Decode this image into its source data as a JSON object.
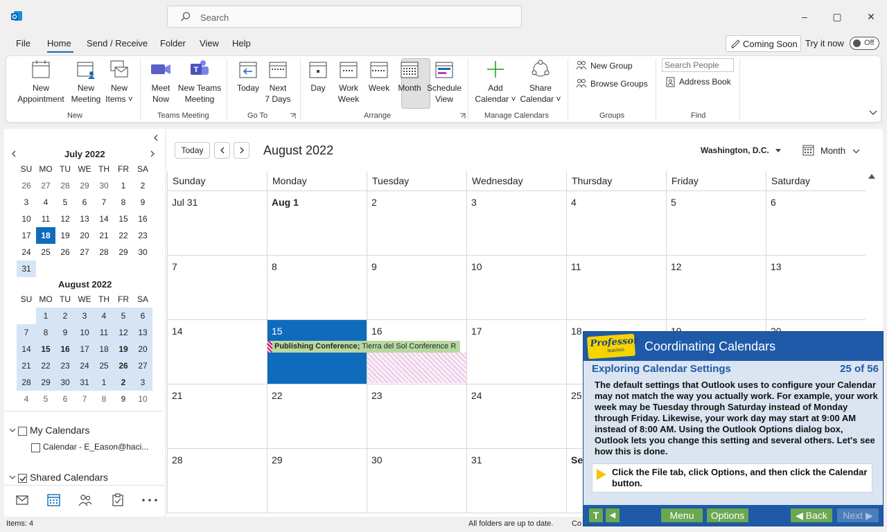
{
  "window": {
    "search_placeholder": "Search",
    "minimize": "–",
    "maximize": "▢",
    "close": "✕"
  },
  "menu": {
    "items": [
      "File",
      "Home",
      "Send / Receive",
      "Folder",
      "View",
      "Help"
    ],
    "coming_soon": "Coming Soon",
    "try_it_now": "Try it now",
    "toggle_state": "Off"
  },
  "ribbon": {
    "new_appointment": [
      "New",
      "Appointment"
    ],
    "new_meeting": [
      "New",
      "Meeting"
    ],
    "new_items": [
      "New",
      "Items ˅"
    ],
    "group_new": "New",
    "meet_now": [
      "Meet",
      "Now"
    ],
    "new_teams_meeting": [
      "New Teams",
      "Meeting"
    ],
    "group_teams": "Teams Meeting",
    "today": "Today",
    "next_7_days": [
      "Next",
      "7 Days"
    ],
    "group_goto": "Go To",
    "day": "Day",
    "work_week": [
      "Work",
      "Week"
    ],
    "week": "Week",
    "month": "Month",
    "schedule_view": [
      "Schedule",
      "View"
    ],
    "group_arrange": "Arrange",
    "add_calendar": [
      "Add",
      "Calendar ˅"
    ],
    "share_calendar": [
      "Share",
      "Calendar ˅"
    ],
    "group_manage": "Manage Calendars",
    "new_group": "New Group",
    "browse_groups": "Browse Groups",
    "group_groups": "Groups",
    "search_people_placeholder": "Search People",
    "address_book": "Address Book",
    "group_find": "Find"
  },
  "mini_calendar": {
    "july_title": "July 2022",
    "august_title": "August 2022",
    "weekdays": [
      "SU",
      "MO",
      "TU",
      "WE",
      "TH",
      "FR",
      "SA"
    ],
    "july_rows": [
      [
        "26",
        "27",
        "28",
        "29",
        "30",
        "1",
        "2"
      ],
      [
        "3",
        "4",
        "5",
        "6",
        "7",
        "8",
        "9"
      ],
      [
        "10",
        "11",
        "12",
        "13",
        "14",
        "15",
        "16"
      ],
      [
        "17",
        "18",
        "19",
        "20",
        "21",
        "22",
        "23"
      ],
      [
        "24",
        "25",
        "26",
        "27",
        "28",
        "29",
        "30"
      ],
      [
        "31",
        "",
        "",
        "",
        "",
        "",
        ""
      ]
    ],
    "august_rows": [
      [
        "",
        "1",
        "2",
        "3",
        "4",
        "5",
        "6"
      ],
      [
        "7",
        "8",
        "9",
        "10",
        "11",
        "12",
        "13"
      ],
      [
        "14",
        "15",
        "16",
        "17",
        "18",
        "19",
        "20"
      ],
      [
        "21",
        "22",
        "23",
        "24",
        "25",
        "26",
        "27"
      ],
      [
        "28",
        "29",
        "30",
        "31",
        "1",
        "2",
        "3"
      ],
      [
        "4",
        "5",
        "6",
        "7",
        "8",
        "9",
        "10"
      ]
    ]
  },
  "folders": {
    "my_calendars": "My Calendars",
    "calendar_item": "Calendar - E_Eason@haci...",
    "shared_calendars": "Shared Calendars"
  },
  "calendar": {
    "today_button": "Today",
    "title": "August 2022",
    "location": "Washington, D.C.",
    "view": "Month",
    "weekdays": [
      "Sunday",
      "Monday",
      "Tuesday",
      "Wednesday",
      "Thursday",
      "Friday",
      "Saturday"
    ],
    "weeks": [
      [
        "Jul 31",
        "Aug 1",
        "2",
        "3",
        "4",
        "5",
        "6"
      ],
      [
        "7",
        "8",
        "9",
        "10",
        "11",
        "12",
        "13"
      ],
      [
        "14",
        "15",
        "16",
        "17",
        "18",
        "19",
        "20"
      ],
      [
        "21",
        "22",
        "23",
        "24",
        "25",
        "",
        ""
      ],
      [
        "28",
        "29",
        "30",
        "31",
        "Se",
        "",
        ""
      ]
    ],
    "event_bold": "Publishing Conference;",
    "event_rest": " Tierra del Sol Conference R"
  },
  "status": {
    "items": "Items: 4",
    "sync": "All folders are up to date.",
    "connected": "Co"
  },
  "tutorial": {
    "logo": "Professor",
    "logo_small": "teaches",
    "title": "Coordinating Calendars",
    "subtitle": "Exploring Calendar Settings",
    "counter": "25 of 56",
    "body": "The default settings that Outlook uses to configure your Calendar may not match the way you actually work. For example, your work week may be Tuesday through Saturday instead of Monday through Friday. Likewise, your work day may start at 9:00 AM instead of 8:00 AM. Using the Outlook Options dialog box, Outlook lets you change this setting and several others. Let's see how this is done.",
    "instruction": "Click the File tab, click Options, and then click the Calendar button.",
    "btn_t": "T",
    "btn_audio": "◀",
    "btn_menu": "Menu",
    "btn_options": "Options",
    "btn_back": "◀ Back",
    "btn_next": "Next ▶"
  },
  "colors": {
    "accent": "#0f6cbd",
    "event": "#b7d8a0",
    "tutorial_blue": "#1e5aa8",
    "tutorial_green": "#6aa84f"
  }
}
